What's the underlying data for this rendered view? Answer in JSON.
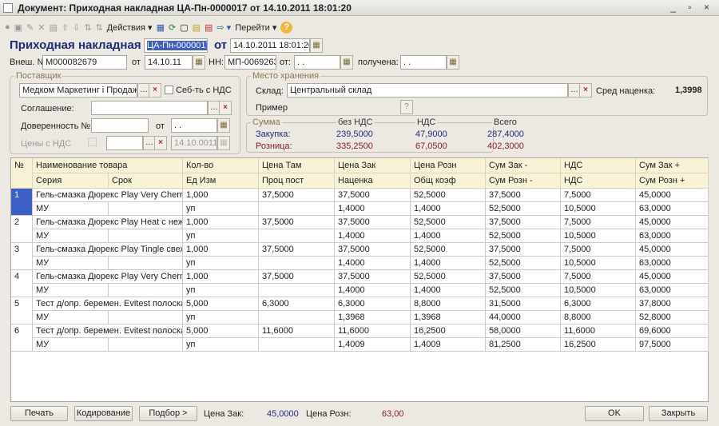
{
  "window": {
    "title": "Документ: Приходная накладная ЦА-Пн-0000017 от 14.10.2011 18:01:20",
    "controls": "_ ▫ ×"
  },
  "toolbar": {
    "actions": "Действия",
    "goto": "Перейти",
    "help": "?"
  },
  "header": {
    "doc_label": "Приходная накладная №",
    "doc_number": "ЦА-Пн-0000017",
    "from_label": "от",
    "doc_date": "14.10.2011 18:01:20",
    "ext_label": "Внеш. №:",
    "ext_number": "М000082679",
    "ext_from": "от",
    "ext_date": "14.10.11",
    "nn_label": "НН:",
    "nn_value": "МП-0069263",
    "nn_from": "от:",
    "nn_date": " . .",
    "received_label": "получена:",
    "received_date": " . ."
  },
  "supplier": {
    "title": "Поставщик",
    "value": "Медком Маркетинг і Продаж У",
    "cost_vat_label": "Себ-ть с НДС",
    "agreement_label": "Соглашение:",
    "agreement": "",
    "power_label": "Доверенность №:",
    "power": "",
    "power_from": "от",
    "power_date": " . .",
    "prices_vat_label": "Цены с НДС",
    "prices_vat_value": "",
    "prices_vat_date": "14.10.0011"
  },
  "storage": {
    "title": "Место хранения",
    "warehouse_label": "Склад:",
    "warehouse": "Центральный склад",
    "avg_markup_label": "Сред наценка:",
    "avg_markup": "1,3998",
    "example_label": "Пример",
    "example_btn": "?"
  },
  "sums": {
    "title": "Сумма",
    "cols": [
      "без НДС",
      "НДС",
      "Всего"
    ],
    "purchase_label": "Закупка:",
    "purchase": [
      "239,5000",
      "47,9000",
      "287,4000"
    ],
    "retail_label": "Розница:",
    "retail": [
      "335,2500",
      "67,0500",
      "402,3000"
    ]
  },
  "colors": {
    "purchase": "#202a80",
    "retail": "#8a1b2c",
    "selection": "#3c5fc8"
  },
  "table": {
    "headers1": [
      "№",
      "Наименование товара",
      "Кол-во",
      "Цена Там",
      "Цена Зак",
      "Цена Розн",
      "Сум Зак -",
      "НДС",
      "Сум Зак +"
    ],
    "headers2": [
      "Серия",
      "Срок",
      "Ед Изм",
      "Проц пост",
      "Наценка",
      "Общ коэф",
      "Сум Розн -",
      "НДС",
      "Сум Розн +"
    ],
    "rows": [
      {
        "n": "1",
        "name": "Гель-смазка Дюрекс Play Very Cherry ...",
        "qty": "1,000",
        "price_customs": "37,5000",
        "price_buy": "37,5000",
        "price_retail": "52,5000",
        "sum_buy_minus": "37,5000",
        "vat1": "7,5000",
        "sum_buy_plus": "45,0000",
        "series": "МУ",
        "term": "",
        "unit": "уп",
        "proc": "",
        "markup": "1,4000",
        "coef": "1,4000",
        "sum_ret_minus": "52,5000",
        "vat2": "10,5000",
        "sum_ret_plus": "63,0000"
      },
      {
        "n": "2",
        "name": "Гель-смазка Дюрекс Play Heat  с неж...",
        "qty": "1,000",
        "price_customs": "37,5000",
        "price_buy": "37,5000",
        "price_retail": "52,5000",
        "sum_buy_minus": "37,5000",
        "vat1": "7,5000",
        "sum_buy_plus": "45,0000",
        "series": "МУ",
        "term": "",
        "unit": "уп",
        "proc": "",
        "markup": "1,4000",
        "coef": "1,4000",
        "sum_ret_minus": "52,5000",
        "vat2": "10,5000",
        "sum_ret_plus": "63,0000"
      },
      {
        "n": "3",
        "name": "Гель-смазка Дюрекс Play Tingle свеж...",
        "qty": "1,000",
        "price_customs": "37,5000",
        "price_buy": "37,5000",
        "price_retail": "52,5000",
        "sum_buy_minus": "37,5000",
        "vat1": "7,5000",
        "sum_buy_plus": "45,0000",
        "series": "МУ",
        "term": "",
        "unit": "уп",
        "proc": "",
        "markup": "1,4000",
        "coef": "1,4000",
        "sum_ret_minus": "52,5000",
        "vat2": "10,5000",
        "sum_ret_plus": "63,0000"
      },
      {
        "n": "4",
        "name": "Гель-смазка Дюрекс Play Very Cherry ...",
        "qty": "1,000",
        "price_customs": "37,5000",
        "price_buy": "37,5000",
        "price_retail": "52,5000",
        "sum_buy_minus": "37,5000",
        "vat1": "7,5000",
        "sum_buy_plus": "45,0000",
        "series": "МУ",
        "term": "",
        "unit": "уп",
        "proc": "",
        "markup": "1,4000",
        "coef": "1,4000",
        "sum_ret_minus": "52,5000",
        "vat2": "10,5000",
        "sum_ret_plus": "63,0000"
      },
      {
        "n": "5",
        "name": "Тест д/опр. беремен. Evitest полоска ...",
        "qty": "5,000",
        "price_customs": "6,3000",
        "price_buy": "6,3000",
        "price_retail": "8,8000",
        "sum_buy_minus": "31,5000",
        "vat1": "6,3000",
        "sum_buy_plus": "37,8000",
        "series": "МУ",
        "term": "",
        "unit": "уп",
        "proc": "",
        "markup": "1,3968",
        "coef": "1,3968",
        "sum_ret_minus": "44,0000",
        "vat2": "8,8000",
        "sum_ret_plus": "52,8000"
      },
      {
        "n": "6",
        "name": "Тест д/опр. беремен. Evitest полоска ...",
        "qty": "5,000",
        "price_customs": "11,6000",
        "price_buy": "11,6000",
        "price_retail": "16,2500",
        "sum_buy_minus": "58,0000",
        "vat1": "11,6000",
        "sum_buy_plus": "69,6000",
        "series": "МУ",
        "term": "",
        "unit": "уп",
        "proc": "",
        "markup": "1,4009",
        "coef": "1,4009",
        "sum_ret_minus": "81,2500",
        "vat2": "16,2500",
        "sum_ret_plus": "97,5000"
      }
    ]
  },
  "footer": {
    "print": "Печать",
    "coding": "Кодирование",
    "selection": "Подбор  >",
    "price_buy_label": "Цена Зак:",
    "price_buy": "45,0000",
    "price_retail_label": "Цена Розн:",
    "price_retail": "63,00",
    "ok": "OK",
    "close": "Закрыть"
  }
}
